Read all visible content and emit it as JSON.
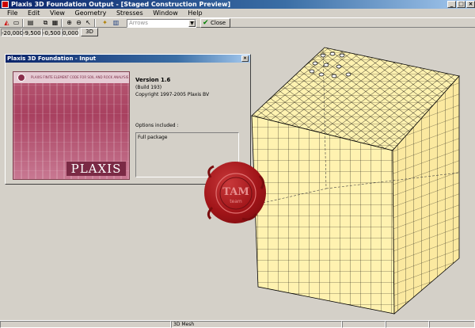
{
  "window": {
    "title": "Plaxis 3D Foundation Output - [Staged Construction Preview]"
  },
  "menu": [
    "File",
    "Edit",
    "View",
    "Geometry",
    "Stresses",
    "Window",
    "Help"
  ],
  "toolbar": {
    "result_type_placeholder": "Arrows",
    "close_label": "Close"
  },
  "coords": {
    "x": "-20,000",
    "y": "-9,500",
    "z": "-0,500",
    "w": "0,000",
    "view_button": "3D"
  },
  "dialog": {
    "title": "Plaxis 3D Foundation - Input",
    "splash_tagline": "PLAXIS FINITE ELEMENT CODE FOR SOIL AND ROCK ANALYSIS",
    "brand": "PLAXIS",
    "version": "Version 1.6",
    "build": "(Build 193)",
    "copyright": "Copyright 1997-2005 Plaxis BV",
    "options_label": "Options included :",
    "options_value": "Full package"
  },
  "seal": {
    "text_top": "TAM",
    "text_bottom": "team"
  },
  "status": {
    "view_mode": "3D Mesh"
  },
  "colors": {
    "titlebar": "#0a246a",
    "mesh_fill": "#fff2b0",
    "mesh_side": "#fbe9a0",
    "seal": "#a01418"
  }
}
